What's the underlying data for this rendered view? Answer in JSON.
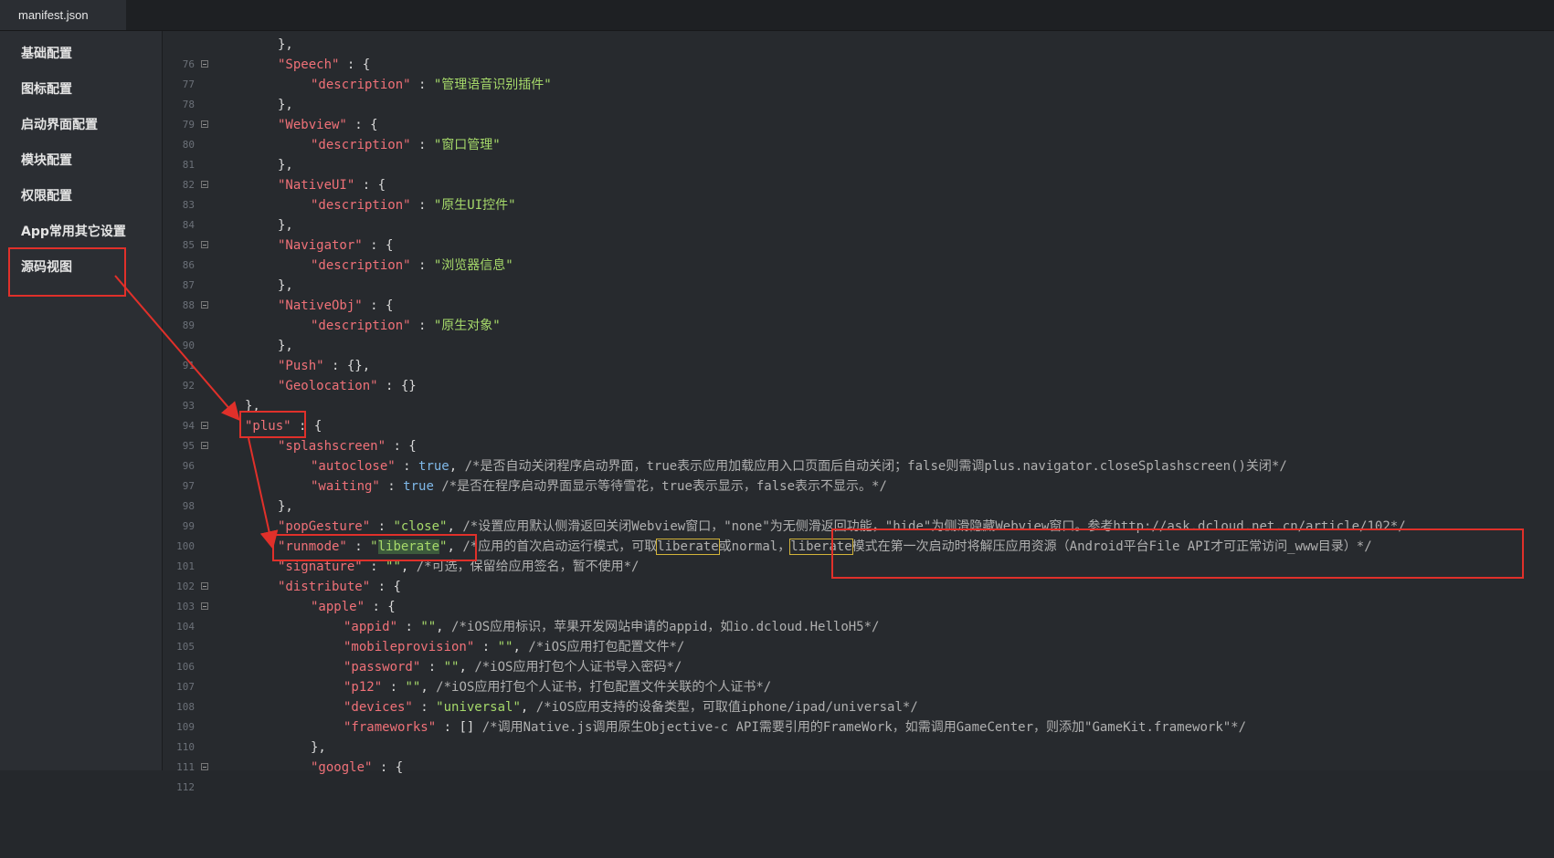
{
  "tab": {
    "title": "manifest.json"
  },
  "sidebar": {
    "items": [
      {
        "label": "基础配置"
      },
      {
        "label": "图标配置"
      },
      {
        "label": "启动界面配置"
      },
      {
        "label": "模块配置"
      },
      {
        "label": "权限配置"
      },
      {
        "label": "App常用其它设置"
      },
      {
        "label": "源码视图"
      }
    ]
  },
  "editor": {
    "line_numbers": [
      "76",
      "77",
      "78",
      "79",
      "80",
      "81",
      "82",
      "83",
      "84",
      "85",
      "86",
      "87",
      "88",
      "89",
      "90",
      "91",
      "92",
      "93",
      "94",
      "95",
      "96",
      "97",
      "98",
      "99",
      "100",
      "101",
      "102",
      "103",
      "104",
      "105",
      "106",
      "107",
      "108",
      "109",
      "110",
      "111",
      "112"
    ],
    "code": {
      "l76": "},",
      "l77_key": "\"Speech\"",
      "l78_key": "\"description\"",
      "l78_val": "\"管理语音识别插件\"",
      "l79": "},",
      "l80_key": "\"Webview\"",
      "l81_key": "\"description\"",
      "l81_val": "\"窗口管理\"",
      "l82": "},",
      "l83_key": "\"NativeUI\"",
      "l84_key": "\"description\"",
      "l84_val": "\"原生UI控件\"",
      "l85": "},",
      "l86_key": "\"Navigator\"",
      "l87_key": "\"description\"",
      "l87_val": "\"浏览器信息\"",
      "l88": "},",
      "l89_key": "\"NativeObj\"",
      "l90_key": "\"description\"",
      "l90_val": "\"原生对象\"",
      "l91": "},",
      "l92_key": "\"Push\"",
      "l92_rest": " : {},",
      "l93_key": "\"Geolocation\"",
      "l93_rest": " : {}",
      "l94": "},",
      "l95_key": "\"plus\"",
      "l96_key": "\"splashscreen\"",
      "l97_key": "\"autoclose\"",
      "l97_val": "true",
      "l97_comment": " /*是否自动关闭程序启动界面，true表示应用加载应用入口页面后自动关闭；false则需调plus.navigator.closeSplashscreen()关闭*/",
      "l98_key": "\"waiting\"",
      "l98_val": "true",
      "l98_comment": " /*是否在程序启动界面显示等待雪花，true表示显示，false表示不显示。*/",
      "l99": "},",
      "l100_key": "\"popGesture\"",
      "l100_val": "\"close\"",
      "l100_comment": " /*设置应用默认侧滑返回关闭Webview窗口，\"none\"为无侧滑返回功能，\"hide\"为侧滑隐藏Webview窗口。参考http://ask.dcloud.net.cn/article/102*/",
      "l101_key": "\"runmode\"",
      "l101_q1": "\"",
      "l101_val": "liberate",
      "l101_q2": "\"",
      "l101_c1": " /*应用的首次启动运行模式，可取",
      "l101_c2": "liberate",
      "l101_c3": "或normal，",
      "l101_c4": "liberate",
      "l101_c5": "模式在第一次启动时将解压应用资源（Android平台File API才可正常访问_www目录）*/",
      "l102_key": "\"signature\"",
      "l102_val": "\"\"",
      "l102_comment": " /*可选，保留给应用签名，暂不使用*/",
      "l103_key": "\"distribute\"",
      "l104_key": "\"apple\"",
      "l105_key": "\"appid\"",
      "l105_val": "\"\"",
      "l105_comment": " /*iOS应用标识，苹果开发网站申请的appid，如io.dcloud.HelloH5*/",
      "l106_key": "\"mobileprovision\"",
      "l106_val": "\"\"",
      "l106_comment": " /*iOS应用打包配置文件*/",
      "l107_key": "\"password\"",
      "l107_val": "\"\"",
      "l107_comment": " /*iOS应用打包个人证书导入密码*/",
      "l108_key": "\"p12\"",
      "l108_val": "\"\"",
      "l108_comment": " /*iOS应用打包个人证书，打包配置文件关联的个人证书*/",
      "l109_key": "\"devices\"",
      "l109_val": "\"universal\"",
      "l109_comment": " /*iOS应用支持的设备类型，可取值iphone/ipad/universal*/",
      "l110_key": "\"frameworks\"",
      "l110_rest": " : [] ",
      "l110_comment": "/*调用Native.js调用原生Objective-c API需要引用的FrameWork，如需调用GameCenter，则添加\"GameKit.framework\"*/",
      "l111": "},",
      "l112_key": "\"google\""
    }
  },
  "colors": {
    "annotation": "#e0302a",
    "string": "#a6d96a",
    "key": "#f07178",
    "bool": "#7fb8e8"
  }
}
